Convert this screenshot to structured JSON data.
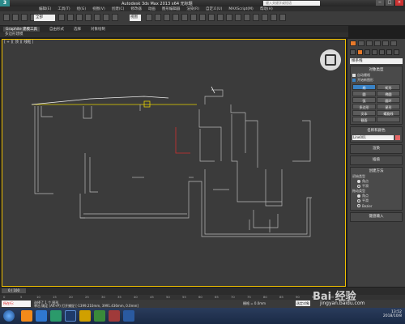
{
  "app": {
    "logo": "3",
    "title": "Autodesk 3ds Max 2013 x64    无标题"
  },
  "titlebar": {
    "search_placeholder": "键入关键字或短语",
    "buttons": [
      "−",
      "□",
      "×"
    ]
  },
  "menu": [
    "编辑(E)",
    "工具(T)",
    "组(G)",
    "视图(V)",
    "创建(C)",
    "修改器",
    "动画",
    "图形编辑器",
    "渲染(R)",
    "自定义(U)",
    "MAXScript(M)",
    "帮助(H)"
  ],
  "toolbar": {
    "selection_filter": "全部",
    "ref_coord": "视图"
  },
  "ribbon": {
    "tabs": [
      "Graphite 建模工具",
      "自由形式",
      "选择",
      "对象绘制"
    ],
    "active": "Graphite 建模工具",
    "sub_label": "多边形建模"
  },
  "viewport": {
    "label": "[ + ][ 顶 ][ 线框 ]"
  },
  "command_panel": {
    "dropdown": "样条线",
    "object_type_header": "对象类型",
    "auto_grid": "自动栅格",
    "start_new_shape": "开始新图形",
    "buttons": [
      "线",
      "矩形",
      "圆",
      "椭圆",
      "弧",
      "圆环",
      "多边形",
      "星形",
      "文本",
      "螺旋线",
      "截面",
      ""
    ],
    "highlight_index": 0,
    "name_color_header": "名称和颜色",
    "name_value": "Line001",
    "swatch_color": "#e66666",
    "render_header": "渲染",
    "interp_header": "插值",
    "create_method_header": "创建方法",
    "init_type_label": "初始类型",
    "init_options": [
      "角点",
      "平滑"
    ],
    "drag_type_label": "拖动类型",
    "drag_options": [
      "角点",
      "平滑",
      "Bezier"
    ],
    "keyboard_header": "键盘输入"
  },
  "timeline": {
    "frame": "0 / 100",
    "ticks": [
      "0",
      "5",
      "10",
      "15",
      "20",
      "25",
      "30",
      "35",
      "40",
      "45",
      "50",
      "55",
      "60",
      "65",
      "70",
      "75",
      "80",
      "85",
      "90",
      "95",
      "100"
    ]
  },
  "status": {
    "left_label": "所在行:",
    "line1": "选择了 1 个 图形",
    "line2": "单击 确定 (Alt+P) 打开捕捉 [-1399.210mm, 3991.436mm, 0.0mm]",
    "grid": "栅格 = 0.0mm",
    "add_time_tag": "添加时间标记",
    "auto_key": "自动关键点",
    "set_key": "设置关键点",
    "selected": "选定对象"
  },
  "taskbar": {
    "time": "13:52",
    "date": "2018/10/8"
  },
  "watermark": {
    "brand": "Bai 经验",
    "url": "jingyan.baidu.com"
  },
  "colors": {
    "viewport_bg": "#3b3b3b",
    "active_border": "#f0c000",
    "highlight": "#3a82c4"
  }
}
